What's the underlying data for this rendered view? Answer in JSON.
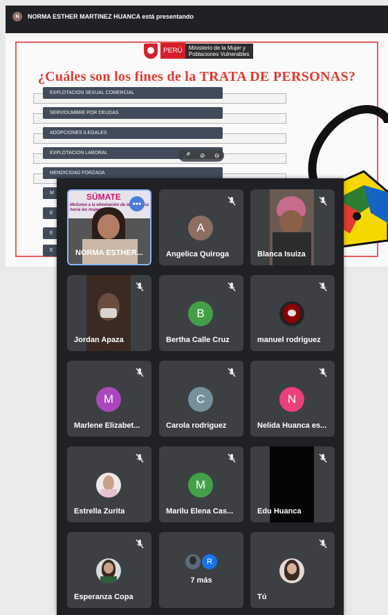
{
  "presentation": {
    "banner": "NORMA ESTHER MARTINEZ HUANCA está presentando",
    "presenter_initial": "N",
    "slide": {
      "logo_country": "PERÚ",
      "logo_ministry": "Ministerio de la Mujer y Poblaciones Vulnerables",
      "title": "¿Cuáles son los fines de la TRATA DE PERSONAS?",
      "answers": [
        "EXPLOTACION SEXUAL COMERCIAL",
        "SERVIDUMBRE POR DEUDAS",
        "ADOPCIONES ILEGALES",
        "EXPLOTACION LABORAL",
        "MENDICIDAD FORZADA",
        "M",
        "E",
        "E",
        "E"
      ]
    }
  },
  "participants": [
    {
      "name": "NORMA ESTHER...",
      "type": "video",
      "muted": false,
      "banner": "SÚMATE",
      "banner_sub": "MeSumo a la eliminación de la violencia hacia las mujeres"
    },
    {
      "name": "Angelica Quiroga",
      "type": "letter",
      "letter": "A",
      "color": "#8d6e63",
      "muted": true
    },
    {
      "name": "Blanca Isuiza",
      "type": "video",
      "muted": true
    },
    {
      "name": "Jordan Apaza",
      "type": "video",
      "muted": true
    },
    {
      "name": "Bertha Calle Cruz",
      "type": "letter",
      "letter": "B",
      "color": "#43a047",
      "muted": true
    },
    {
      "name": "manuel rodriguez",
      "type": "photo",
      "muted": true
    },
    {
      "name": "Marlene Elizabet...",
      "type": "letter",
      "letter": "M",
      "color": "#ab47bc",
      "muted": true
    },
    {
      "name": "Carola rodriguez",
      "type": "letter",
      "letter": "C",
      "color": "#78909c",
      "muted": true
    },
    {
      "name": "Nelida Huanca es...",
      "type": "letter",
      "letter": "N",
      "color": "#ec407a",
      "muted": true
    },
    {
      "name": "Estrella Zurita",
      "type": "photo",
      "muted": true
    },
    {
      "name": "Marilu Elena Cas...",
      "type": "letter",
      "letter": "M",
      "color": "#43a047",
      "muted": true
    },
    {
      "name": "Edu Huanca",
      "type": "video",
      "muted": true
    },
    {
      "name": "Esperanza Copa",
      "type": "photo",
      "muted": true
    },
    {
      "name": "7 más",
      "type": "more",
      "letter": "R",
      "muted": false
    },
    {
      "name": "Tú",
      "type": "photo",
      "muted": true
    }
  ],
  "icons": {
    "mute": "mic-off-icon",
    "more_options": "more-options-icon"
  }
}
